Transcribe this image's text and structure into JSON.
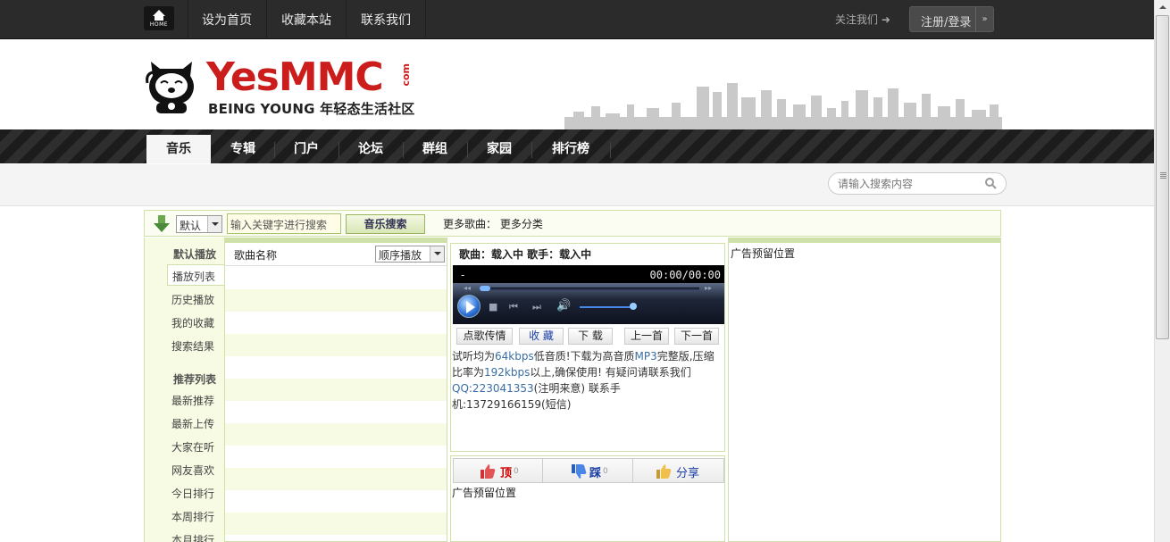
{
  "topbar": {
    "home_label": "HOME",
    "links": [
      "设为首页",
      "收藏本站",
      "联系我们"
    ],
    "follow": "关注我们",
    "login": "注册/登录"
  },
  "logo": {
    "brand": "YesMMC",
    "com": "com",
    "slogan": "BEING YOUNG 年轻态生活社区"
  },
  "nav": {
    "items": [
      "音乐",
      "专辑",
      "门户",
      "论坛",
      "群组",
      "家园",
      "排行榜"
    ],
    "active_index": 0
  },
  "site_search": {
    "placeholder": "请输入搜索内容"
  },
  "music_bar": {
    "select_value": "默认",
    "keyword_placeholder": "输入关键字进行搜索",
    "search_button": "音乐搜索",
    "more_songs": "更多歌曲：",
    "more_categories": "更多分类"
  },
  "left_menu": {
    "group1_title": "默认播放",
    "group1_items": [
      "播放列表",
      "历史播放",
      "我的收藏",
      "搜索结果"
    ],
    "group2_title": "推荐列表",
    "group2_items": [
      "最新推荐",
      "最新上传",
      "大家在听",
      "网友喜欢",
      "今日排行",
      "本周排行",
      "本月排行"
    ]
  },
  "song_list": {
    "header": "歌曲名称",
    "order_select": "顺序播放"
  },
  "player": {
    "info": "歌曲：载入中  歌手：载入中",
    "dash": "-",
    "time": "00:00/00:00",
    "buttons": [
      "点歌传情",
      "收 藏",
      "下 载",
      "上一首",
      "下一首"
    ],
    "note_a": "试听均为",
    "note_b": "64kbps",
    "note_c": "低音质!下载为高音质",
    "note_d": "MP3",
    "note_e": "完整版,压缩比率为",
    "note_f": "192kbps",
    "note_g": "以上,确保使用! 有疑问请联系我们",
    "note_h": "QQ:223041353",
    "note_i": "(注明来意) 联系手机:13729166159(短信)",
    "progress": 0,
    "volume": 0.85
  },
  "votes": {
    "up_label": "顶",
    "up_count": "0",
    "down_label": "踩",
    "down_count": "0",
    "share_label": "分享"
  },
  "ads": {
    "under_player": "广告预留位置",
    "right_panel": "广告预留位置"
  }
}
